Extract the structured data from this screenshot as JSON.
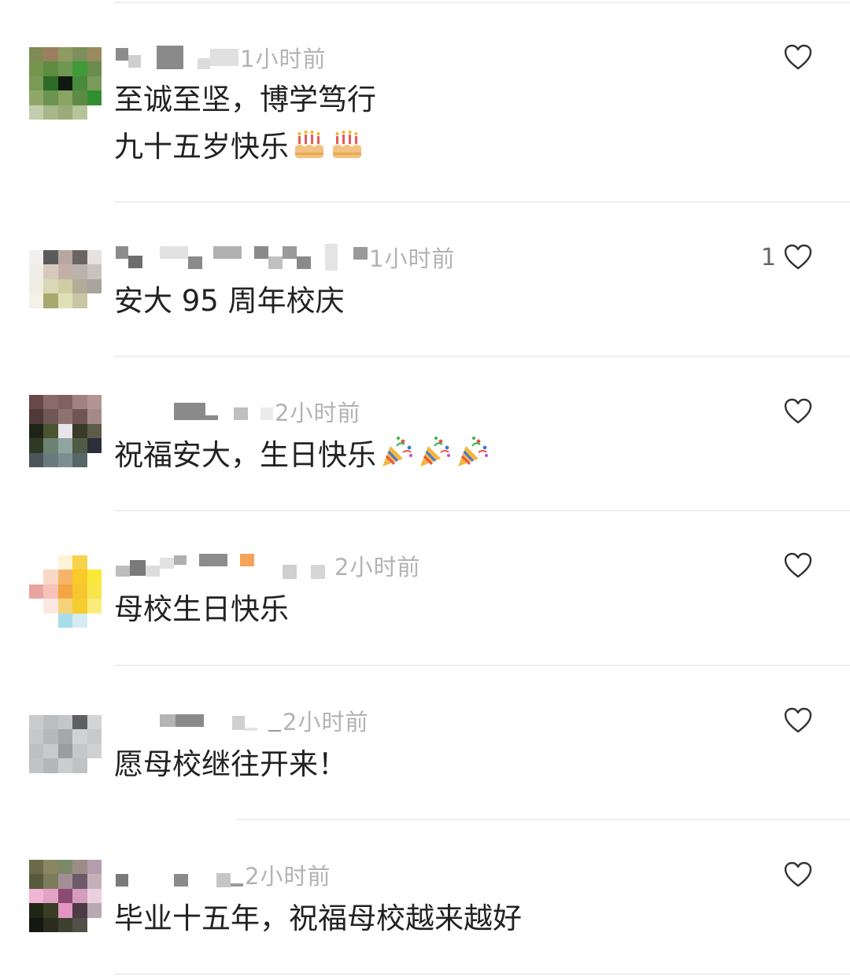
{
  "comments": [
    {
      "time": "1小时前",
      "lines": [
        "至诚至坚，博学笃行",
        "九十五岁快乐"
      ],
      "emoji": "cake-icon",
      "emoji_count": 2,
      "likes": ""
    },
    {
      "time": "1小时前",
      "lines": [
        "安大 95 周年校庆"
      ],
      "likes": "1"
    },
    {
      "time": "2小时前",
      "lines": [
        "祝福安大，生日快乐"
      ],
      "emoji": "party-popper-icon",
      "emoji_count": 3,
      "likes": ""
    },
    {
      "time": "2小时前",
      "lines": [
        "母校生日快乐"
      ],
      "likes": ""
    },
    {
      "time": "2小时前",
      "lines": [
        "愿母校继往开来！"
      ],
      "likes": ""
    },
    {
      "time": "2小时前",
      "lines": [
        "毕业十五年，祝福母校越来越好"
      ],
      "likes": ""
    }
  ],
  "colors": {
    "text": "#222222",
    "time": "#b3b3b3",
    "divider": "#eeeeee",
    "heart_stroke": "#333333"
  }
}
